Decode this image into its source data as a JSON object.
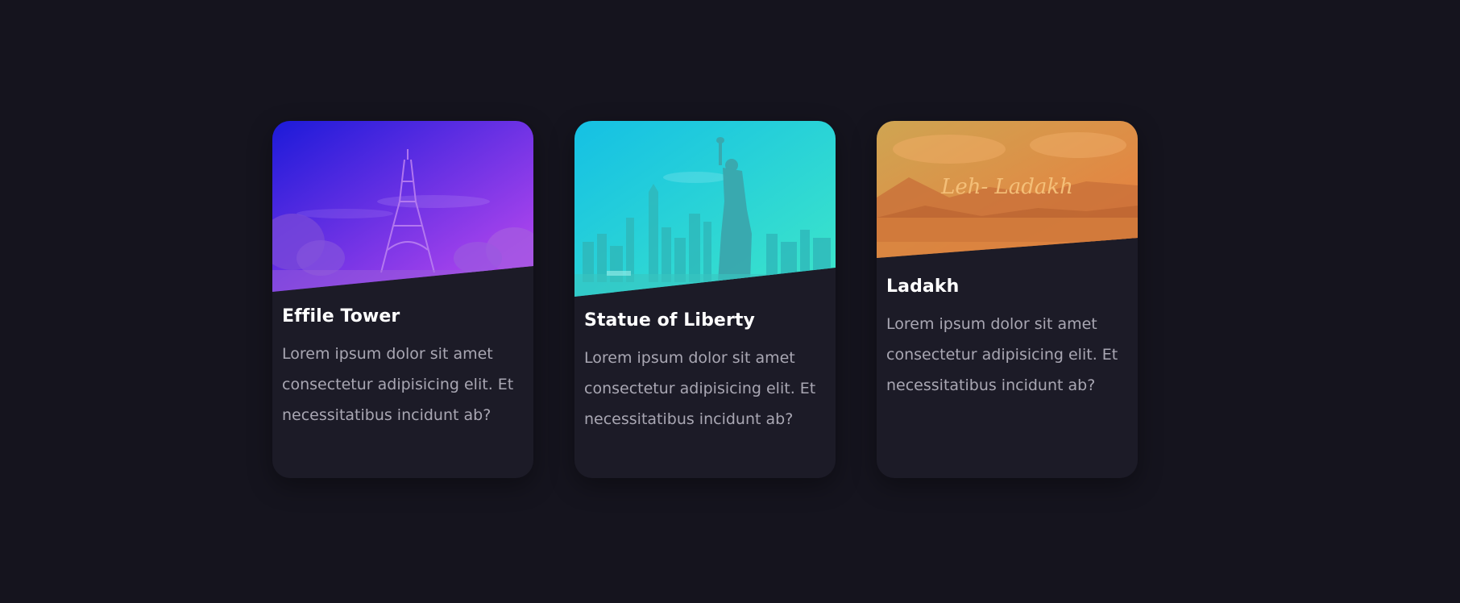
{
  "cards": [
    {
      "title": "Effile Tower",
      "text": "Lorem ipsum dolor sit amet consectetur adipisicing elit. Et necessitatibus incidunt ab?",
      "image_icon": "eiffel-tower-icon",
      "gradient": [
        "#1c1ad9",
        "#c24bf0"
      ]
    },
    {
      "title": "Statue of Liberty",
      "text": "Lorem ipsum dolor sit amet consectetur adipisicing elit. Et necessitatibus incidunt ab?",
      "image_icon": "statue-of-liberty-icon",
      "gradient": [
        "#15c0e4",
        "#3ee6c9"
      ]
    },
    {
      "title": "Ladakh",
      "text": "Lorem ipsum dolor sit amet consectetur adipisicing elit. Et necessitatibus incidunt ab?",
      "image_icon": "mountain-lake-icon",
      "image_caption": "Leh- Ladakh",
      "gradient": [
        "#d99a4a",
        "#e3763a"
      ]
    }
  ]
}
